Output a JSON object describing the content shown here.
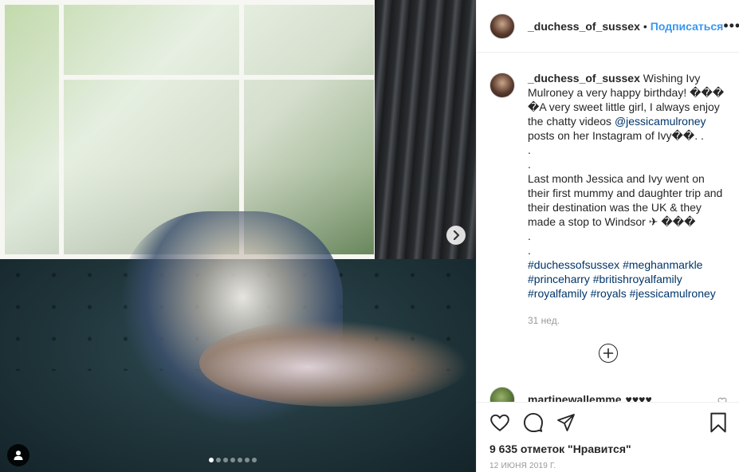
{
  "post": {
    "username": "_duchess_of_sussex",
    "separator": "•",
    "follow_label": "Подписаться",
    "more_label": "•••"
  },
  "caption": {
    "username": "_duchess_of_sussex",
    "lines": [
      "Wishing Ivy Mulroney a very happy birthday! ��� �A very sweet little girl, I always enjoy the chatty videos",
      "@jessicamulroney",
      "posts on her Instagram of Ivy��. .",
      ".",
      ".",
      "Last month Jessica and Ivy went on their first mummy and daughter trip and their destination was the UK & they made a stop to Windsor ✈ ���",
      ".",
      "."
    ],
    "hashtags": [
      "#duchessofsussex",
      "#meghanmarkle",
      "#princeharry",
      "#britishroyalfamily",
      "#royalfamily",
      "#royals",
      "#jessicamulroney"
    ],
    "time_ago": "31 нед."
  },
  "comment": {
    "username": "martinewallemme",
    "text": "♥♥♥♥"
  },
  "footer": {
    "likes": "9 635 отметок \"Нравится\"",
    "date": "12 ИЮНЯ 2019 Г."
  },
  "carousel": {
    "total": 7,
    "active_index": 0
  },
  "icons": {
    "next": "chevron-right-icon",
    "user_tag": "user-tag-icon",
    "load_more": "plus-circle-icon",
    "like": "heart-icon",
    "comment": "comment-icon",
    "share": "share-icon",
    "save": "bookmark-icon"
  },
  "colors": {
    "link": "#3897f0",
    "hashtag": "#003569",
    "muted": "#999999"
  }
}
